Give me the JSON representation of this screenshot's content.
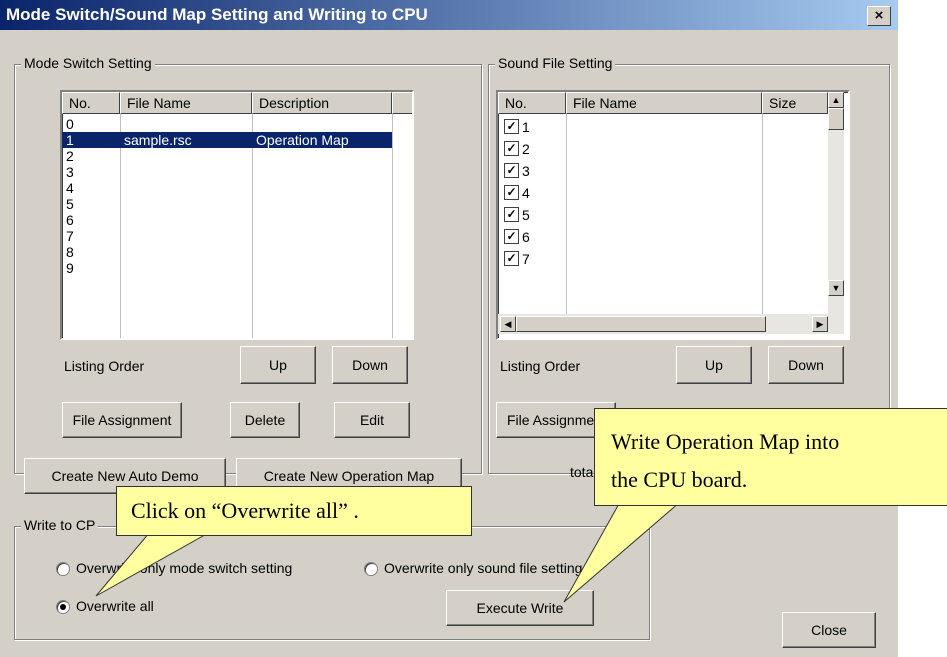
{
  "window": {
    "title": "Mode Switch/Sound Map Setting and Writing to CPU",
    "close_label": "×"
  },
  "mode_switch": {
    "group_title": "Mode Switch Setting",
    "columns": [
      "No.",
      "File Name",
      "Description"
    ],
    "rows": [
      {
        "no": "0",
        "file": "",
        "desc": ""
      },
      {
        "no": "1",
        "file": "sample.rsc",
        "desc": "Operation Map"
      },
      {
        "no": "2",
        "file": "",
        "desc": ""
      },
      {
        "no": "3",
        "file": "",
        "desc": ""
      },
      {
        "no": "4",
        "file": "",
        "desc": ""
      },
      {
        "no": "5",
        "file": "",
        "desc": ""
      },
      {
        "no": "6",
        "file": "",
        "desc": ""
      },
      {
        "no": "7",
        "file": "",
        "desc": ""
      },
      {
        "no": "8",
        "file": "",
        "desc": ""
      },
      {
        "no": "9",
        "file": "",
        "desc": ""
      }
    ],
    "listing_order_label": "Listing Order",
    "up_label": "Up",
    "down_label": "Down",
    "file_assignment_label": "File Assignment",
    "delete_label": "Delete",
    "edit_label": "Edit",
    "create_auto_demo_label": "Create New Auto Demo",
    "create_operation_map_label": "Create New Operation Map"
  },
  "sound_file": {
    "group_title": "Sound File Setting",
    "columns": [
      "No.",
      "File Name",
      "Size"
    ],
    "rows": [
      {
        "no": "1",
        "checked": true
      },
      {
        "no": "2",
        "checked": true
      },
      {
        "no": "3",
        "checked": true
      },
      {
        "no": "4",
        "checked": true
      },
      {
        "no": "5",
        "checked": true
      },
      {
        "no": "6",
        "checked": true
      },
      {
        "no": "7",
        "checked": true
      }
    ],
    "listing_order_label": "Listing Order",
    "up_label": "Up",
    "down_label": "Down",
    "file_assignment_label": "File Assignme",
    "total_label": "total:0"
  },
  "write": {
    "group_title": "Write to CP",
    "opt_mode_switch": "Overwrite only mode switch setting",
    "opt_sound_file": "Overwrite only sound file setting",
    "opt_all": "Overwrite all",
    "execute_label": "Execute Write",
    "close_label": "Close"
  },
  "callouts": {
    "overwrite_all": "Click on “Overwrite all” .",
    "write_map_line1": "Write Operation Map into",
    "write_map_line2": "the CPU board."
  }
}
